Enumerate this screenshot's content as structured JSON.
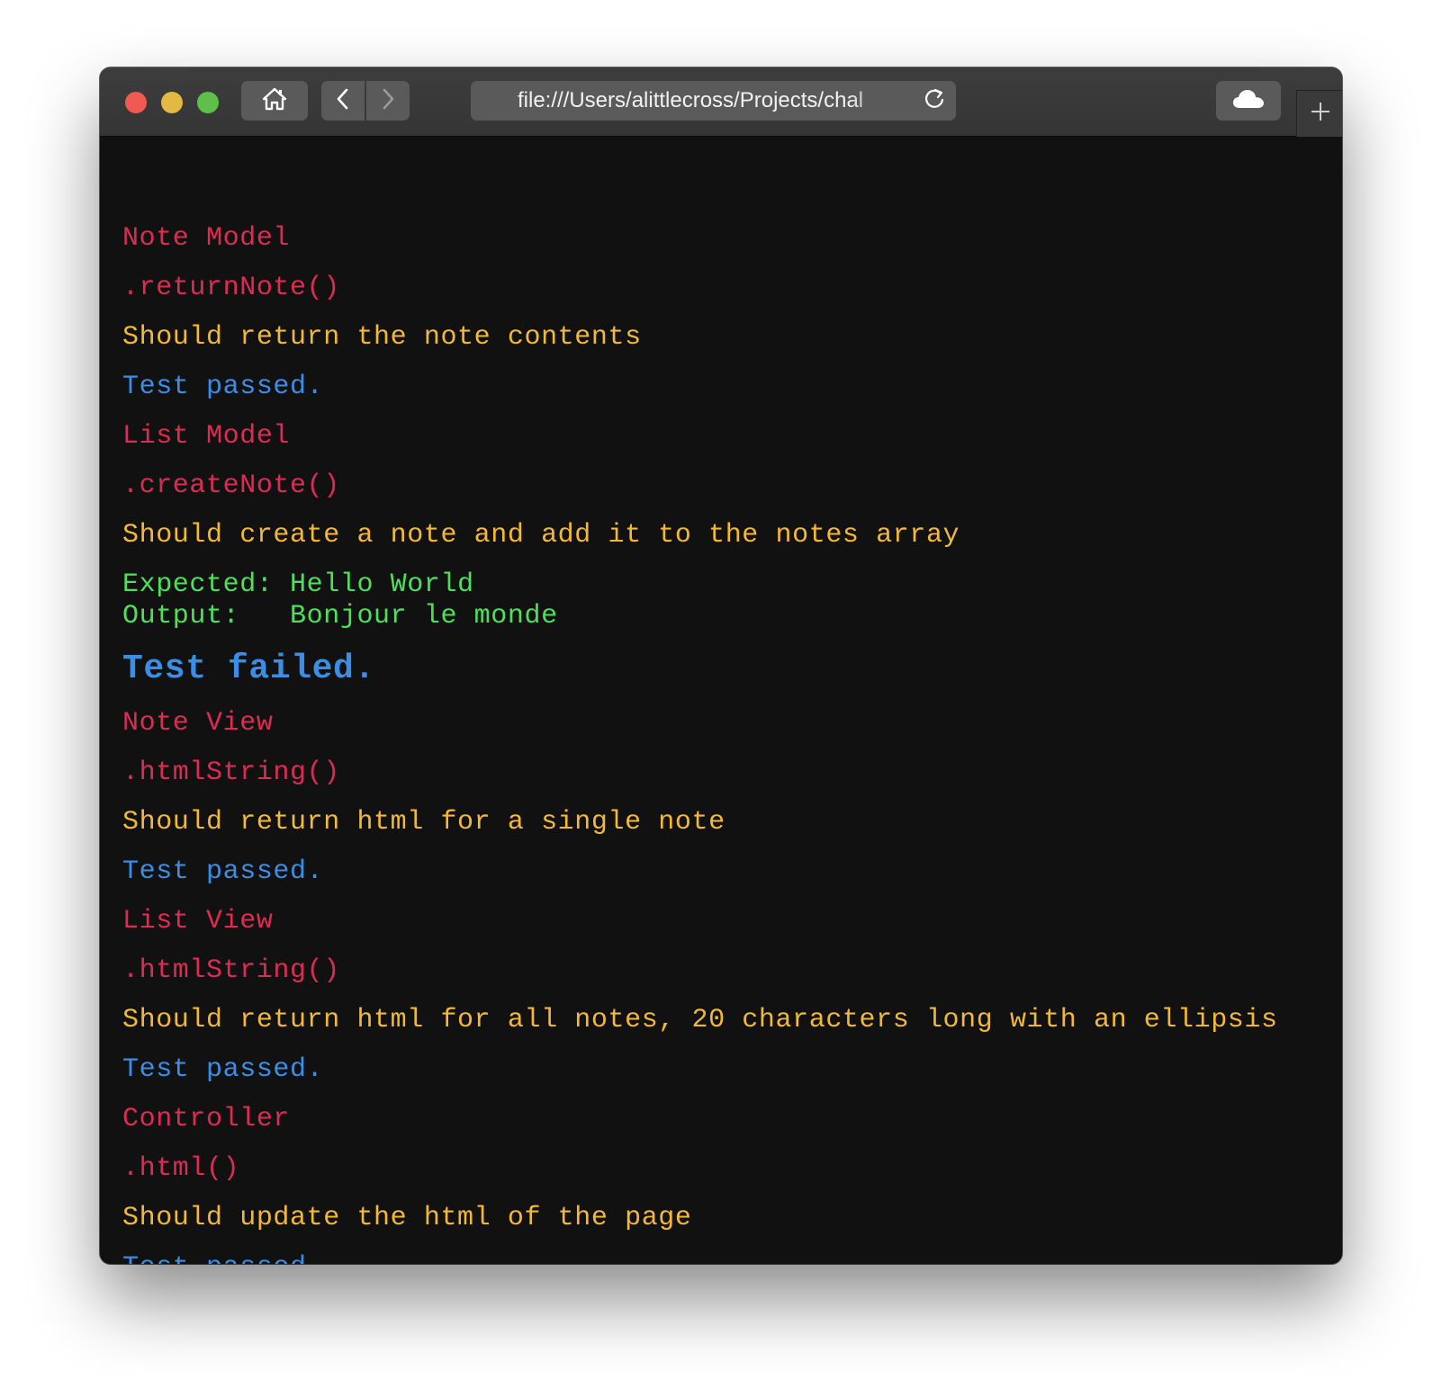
{
  "browser": {
    "address": "file:///Users/alittlecross/Projects/chal",
    "buttons": {
      "home": "home-icon",
      "back": "chevron-left-icon",
      "forward": "chevron-right-icon",
      "reload": "reload-icon",
      "cloud": "cloud-icon",
      "new_tab": "plus-icon"
    }
  },
  "colors": {
    "describe": "#dc2c54",
    "it": "#f3b935",
    "result": "#3b8ee5",
    "diff": "#4fe05a",
    "background": "#111111"
  },
  "output": {
    "note_model": {
      "title": "Note Model",
      "method": ".returnNote()",
      "spec": "Should return the note contents",
      "result": "Test passed."
    },
    "list_model": {
      "title": "List Model",
      "method": ".createNote()",
      "spec": "Should create a note and add it to the notes array",
      "expected_label": "Expected:",
      "expected_value": "Hello World",
      "output_label": "Output:",
      "output_value": "Bonjour le monde",
      "result": "Test failed."
    },
    "note_view": {
      "title": "Note View",
      "method": ".htmlString()",
      "spec": "Should return html for a single note",
      "result": "Test passed."
    },
    "list_view": {
      "title": "List View",
      "method": ".htmlString()",
      "spec": "Should return html for all notes, 20 characters long with an ellipsis",
      "result": "Test passed."
    },
    "controller": {
      "title": "Controller",
      "method": ".html()",
      "spec": "Should update the html of the page",
      "result": "Test passed."
    }
  }
}
